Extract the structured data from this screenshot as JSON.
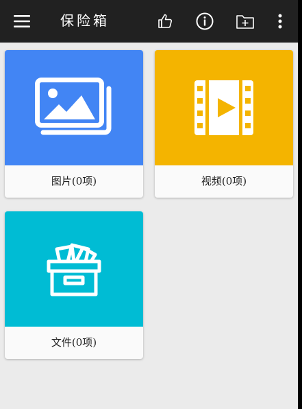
{
  "app_bar": {
    "title": "保险箱",
    "background": "#212121",
    "icons": [
      "menu-icon",
      "thumbs-up-icon",
      "info-icon",
      "add-folder-icon",
      "more-vert-icon"
    ]
  },
  "categories": [
    {
      "label": "图片(0项)",
      "icon": "image-gallery-icon",
      "color": "#4285f4"
    },
    {
      "label": "视频(0项)",
      "icon": "video-film-icon",
      "color": "#f4b400"
    },
    {
      "label": "文件(0项)",
      "icon": "archive-box-icon",
      "color": "#00bcd4"
    }
  ],
  "colors": {
    "screen_background": "#ebebeb",
    "card_label_background": "#fafafa"
  }
}
